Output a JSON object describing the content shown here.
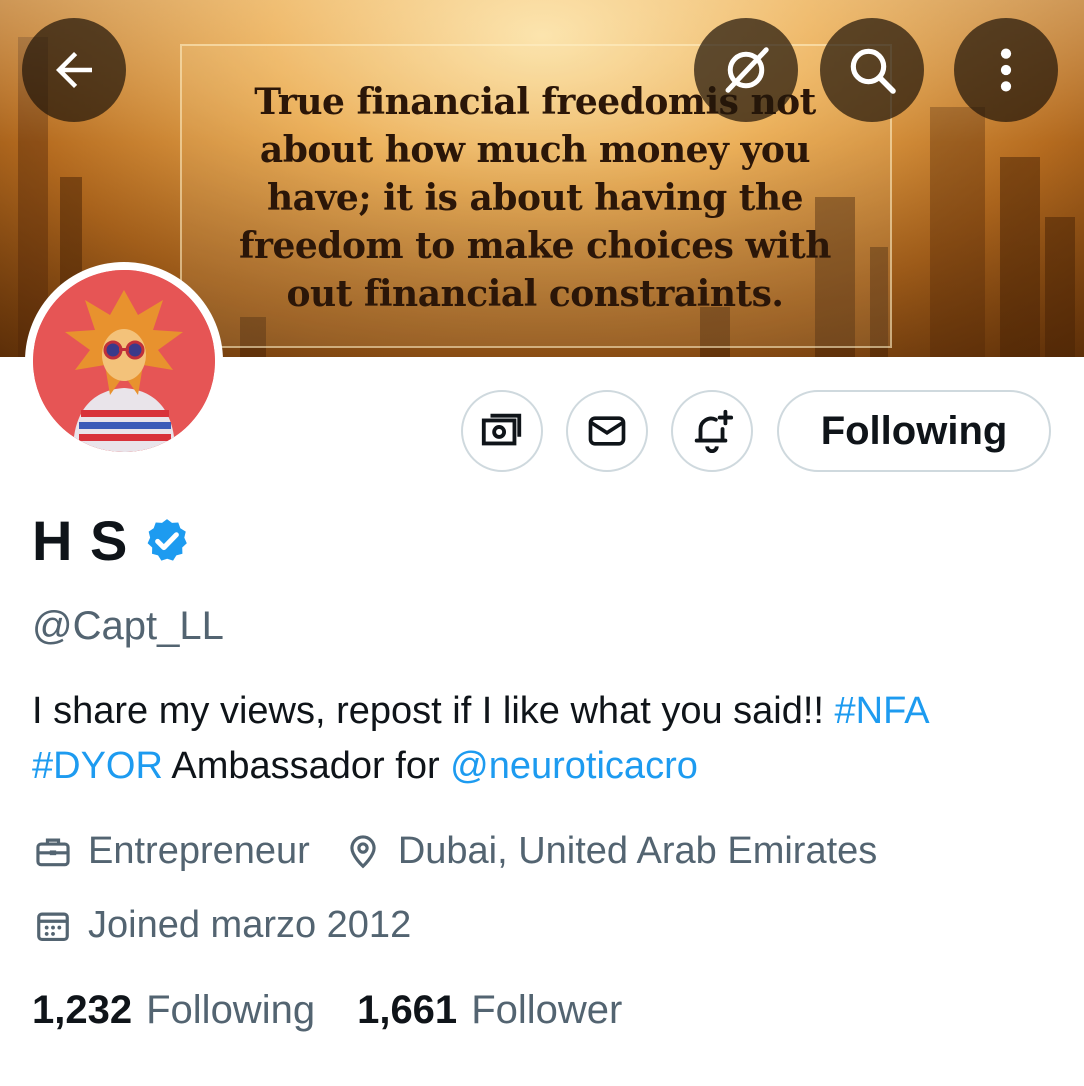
{
  "banner": {
    "quote_lines": [
      "True financial freedomis not",
      "about how much money you",
      "have; it is about having the",
      "freedom to make choices with",
      "out financial constraints."
    ]
  },
  "topbar": {
    "back_icon": "arrow-left-icon",
    "grok_icon": "grok-icon",
    "search_icon": "search-icon",
    "more_icon": "more-vertical-icon"
  },
  "actions": {
    "tip_icon": "money-icon",
    "message_icon": "envelope-icon",
    "notify_icon": "bell-plus-icon",
    "following_label": "Following"
  },
  "profile": {
    "name": "H S",
    "verified": true,
    "verified_color": "#1d9bf0",
    "handle": "@Capt_LL",
    "bio": {
      "text1": "I share my views, repost if I like what you said!! ",
      "tag1": "#NFA",
      "tag2": "#DYOR",
      "text2": " Ambassador for ",
      "mention": "@neuroticacro"
    },
    "profession": "Entrepreneur",
    "location": "Dubai, United Arab Emirates",
    "joined": "Joined marzo 2012",
    "following_count": "1,232",
    "following_label": "Following",
    "follower_count": "1,661",
    "follower_label": "Follower"
  },
  "colors": {
    "accent": "#1d9bf0",
    "muted": "#536471",
    "border": "#cfd9de"
  }
}
